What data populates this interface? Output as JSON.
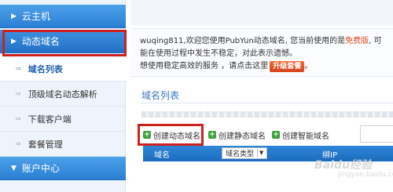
{
  "sidebar": {
    "categories": [
      {
        "label": "云主机"
      },
      {
        "label": "动态域名"
      },
      {
        "label": "账户中心"
      }
    ],
    "items": [
      {
        "label": "域名列表",
        "active": true
      },
      {
        "label": "顶级域名动态解析"
      },
      {
        "label": "下载客户端"
      },
      {
        "label": "套餐管理"
      }
    ]
  },
  "notice": {
    "username": "wuqing811",
    "line1_text": ",欢迎您使用PubYun动态域名, 您当前使用的是",
    "plan": "免费版",
    "line2_text": ", 可能在使用过程中发生不稳定，对此表示遗憾。",
    "line3_text": "想使用稳定高效的服务 ，请点击这里",
    "upgrade_label": "升级套餐",
    "line3_end": "。"
  },
  "main": {
    "title": "域名列表",
    "buttons": {
      "create_dynamic": "创建动态域名",
      "create_static": "创建静态域名",
      "create_smart": "创建智能域名"
    },
    "table": {
      "col_domain": "域名",
      "col_type_select": "域名类型",
      "col_ip": "绑IP"
    }
  },
  "watermark": {
    "text": "Baidu经验",
    "sub": "jingyan.baidu.com"
  },
  "colors": {
    "accent": "#2a7fd4",
    "highlight": "#cf2020",
    "upgrade": "#e24a1a",
    "add": "#3ea23e"
  }
}
